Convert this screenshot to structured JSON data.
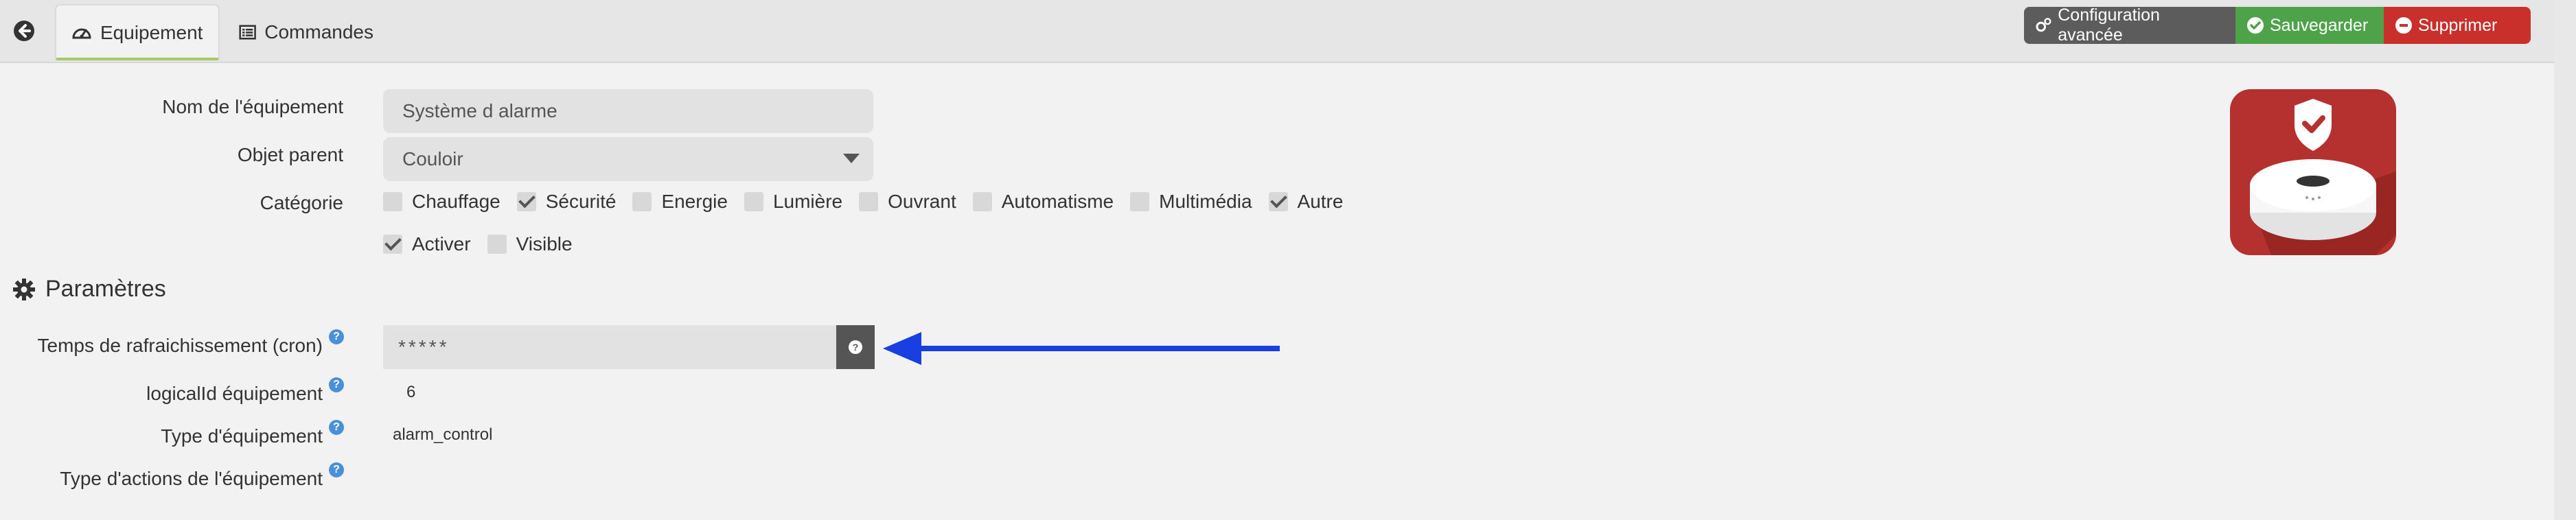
{
  "tabs": [
    {
      "label": "Equipement",
      "icon": "tachometer-icon",
      "active": true
    },
    {
      "label": "Commandes",
      "icon": "list-icon",
      "active": false
    }
  ],
  "actions": {
    "config_label": "Configuration avancée",
    "save_label": "Sauvegarder",
    "delete_label": "Supprimer"
  },
  "colors": {
    "config": "#5c5c5c",
    "save": "#4ea24a",
    "delete": "#c9302c",
    "help": "#4a90d9",
    "arrow": "#1a3fe0",
    "icon_bg": "#b5312f"
  },
  "form": {
    "name_label": "Nom de l'équipement",
    "name_value": "Système d alarme",
    "parent_label": "Objet parent",
    "parent_value": "Couloir",
    "category_label": "Catégorie",
    "categories": [
      {
        "label": "Chauffage",
        "checked": false
      },
      {
        "label": "Sécurité",
        "checked": true
      },
      {
        "label": "Energie",
        "checked": false
      },
      {
        "label": "Lumière",
        "checked": false
      },
      {
        "label": "Ouvrant",
        "checked": false
      },
      {
        "label": "Automatisme",
        "checked": false
      },
      {
        "label": "Multimédia",
        "checked": false
      },
      {
        "label": "Autre",
        "checked": true
      }
    ],
    "states": [
      {
        "label": "Activer",
        "checked": true
      },
      {
        "label": "Visible",
        "checked": false
      }
    ]
  },
  "params": {
    "title": "Paramètres",
    "cron_label": "Temps de rafraichissement (cron)",
    "cron_value": "*****",
    "logical_label": "logicalId équipement",
    "logical_value": "6",
    "type_label": "Type d'équipement",
    "type_value": "alarm_control",
    "actions_label": "Type d'actions de l'équipement",
    "help_glyph": "?"
  }
}
